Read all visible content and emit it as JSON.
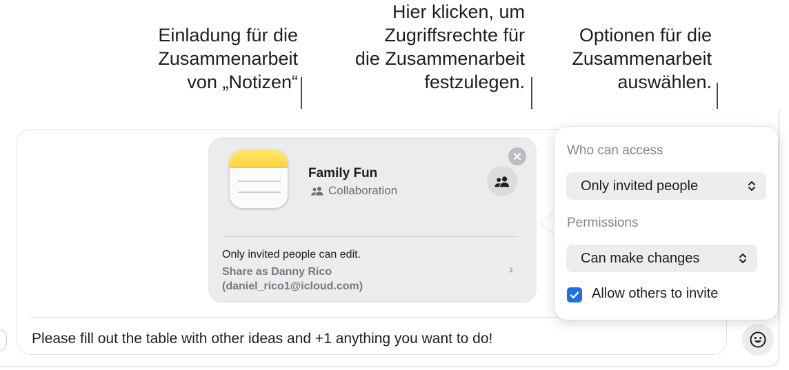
{
  "callouts": {
    "invitation": [
      "Einladung für die",
      "Zusammenarbeit",
      "von „Notizen“"
    ],
    "access_rights": [
      "Hier klicken, um",
      "Zugriffsrechte für",
      "die Zusammenarbeit",
      "festzulegen."
    ],
    "options": [
      "Optionen für die",
      "Zusammenarbeit",
      "auswählen."
    ]
  },
  "card": {
    "title": "Family Fun",
    "subtitle": "Collaboration",
    "status": "Only invited people can edit.",
    "share_as": "Share as Danny Rico",
    "email": "(daniel_rico1@icloud.com)"
  },
  "popover": {
    "access_label": "Who can access",
    "access_value": "Only invited people",
    "permissions_label": "Permissions",
    "permissions_value": "Can make changes",
    "allow_invite_label": "Allow others to invite",
    "allow_invite_checked": true
  },
  "compose": {
    "message": "Please fill out the table with other ideas and +1 anything you want to do!"
  },
  "icons": {
    "app": "notes-app-icon",
    "collaboration": "people-icon",
    "close": "close-icon",
    "chevron": "chevron-right-icon",
    "stepper": "up-down-chevron-icon",
    "checkbox": "checkmark-icon",
    "emoji": "emoji-icon"
  },
  "colors": {
    "accent": "#1f6fe5",
    "notes_yellow": "#fdd33a",
    "card_background": "#ececee"
  }
}
